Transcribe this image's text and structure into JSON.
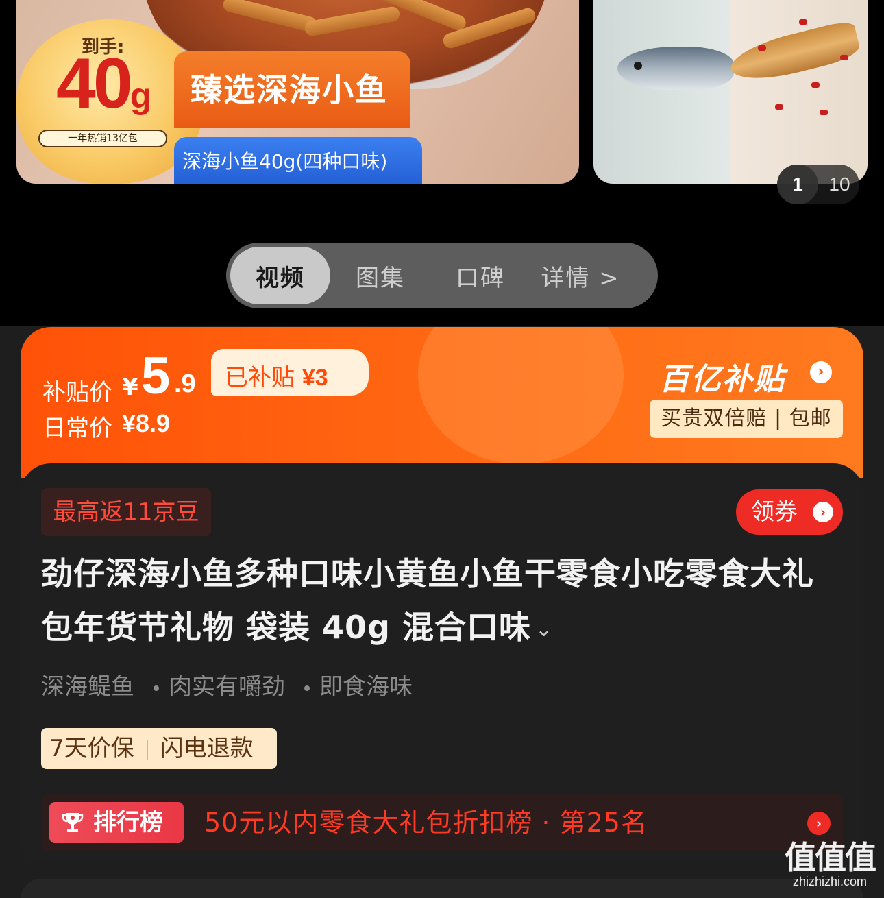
{
  "carousel": {
    "main_slide": {
      "badge_label": "到手:",
      "badge_value": "40",
      "badge_unit": "g",
      "badge_sales": "一年热销13亿包",
      "banner_text": "臻选深海小鱼",
      "tag_text": "深海小鱼40g(四种口味)"
    },
    "pager": {
      "current": "1",
      "total": "10"
    }
  },
  "media_tabs": [
    {
      "label": "视频",
      "active": true
    },
    {
      "label": "图集",
      "active": false
    },
    {
      "label": "口碑",
      "active": false
    },
    {
      "label": "详情 >",
      "active": false
    }
  ],
  "price": {
    "subsidy_label": "补贴价",
    "currency": "¥",
    "subsidy_int": "5",
    "subsidy_dec": ".9",
    "subsidy_chip_text": "已补贴",
    "subsidy_chip_amount": "¥3",
    "daily_label": "日常价",
    "daily_value": "¥8.9",
    "brand": "百亿补贴",
    "guarantee": "买贵双倍赔 | 包邮",
    "colors": {
      "accent": "#ff5208",
      "chip_bg": "#fff1dc",
      "guarantee_bg": "#ffe8c2"
    }
  },
  "product": {
    "bean_tag": "最高返11京豆",
    "coupon_label": "领券",
    "title": "劲仔深海小鱼多种口味小黄鱼小鱼干零食小吃零食大礼包年货节礼物 袋装 40g 混合口味",
    "features": [
      "深海鳀鱼",
      "肉实有嚼劲",
      "即食海味"
    ],
    "service_tags": [
      "7天价保",
      "闪电退款"
    ],
    "rank_badge": "排行榜",
    "rank_text": "50元以内零食大礼包折扣榜 · 第25名"
  },
  "watermark": {
    "logo": "值值值",
    "url": "zhizhizhi.com"
  }
}
